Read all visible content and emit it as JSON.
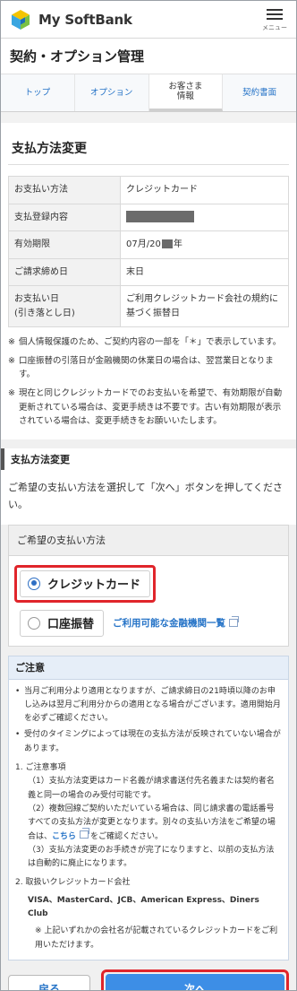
{
  "header": {
    "brand": "My SoftBank",
    "menu_label": "メニュー"
  },
  "page_title": "契約・オプション管理",
  "tabs": [
    {
      "label": "トップ",
      "active": false
    },
    {
      "label": "オプション",
      "active": false
    },
    {
      "label_line1": "お客さま",
      "label_line2": "情報",
      "active": true
    },
    {
      "label": "契約書面",
      "active": false
    }
  ],
  "section_title": "支払方法変更",
  "info_rows": [
    {
      "key": "お支払い方法",
      "value": "クレジットカード"
    },
    {
      "key": "支払登録内容",
      "value": ""
    },
    {
      "key": "有効期限",
      "value_prefix": "07月/20",
      "value_suffix": "年"
    },
    {
      "key": "ご請求締め日",
      "value": "末日"
    },
    {
      "key_line1": "お支払い日",
      "key_line2": "(引き落とし日)",
      "value": "ご利用クレジットカード会社の規約に基づく振替日"
    }
  ],
  "notes": [
    "個人情報保護のため、ご契約内容の一部を「＊」で表示しています。",
    "口座振替の引落日が金融機関の休業日の場合は、翌営業日となります。",
    "現在と同じクレジットカードでのお支払いを希望で、有効期限が自動更新されている場合は、変更手続きは不要です。古い有効期限が表示されている場合は、変更手続きをお願いいたします。"
  ],
  "note_mark": "※",
  "change_section": {
    "title": "支払方法変更",
    "lead": "ご希望の支払い方法を選択して「次へ」ボタンを押してください。",
    "panel_title": "ご希望の支払い方法",
    "options": [
      {
        "label": "クレジットカード",
        "selected": true
      },
      {
        "label": "口座振替",
        "selected": false
      }
    ],
    "bank_link": "ご利用可能な金融機関一覧"
  },
  "caution": {
    "title": "ご注意",
    "bullets": [
      "当月ご利用分より適用となりますが、ご請求締日の21時頃以降のお申し込みは翌月ご利用分からの適用となる場合がございます。適用開始月を必ずご確認ください。",
      "受付のタイミングによっては現在の支払方法が反映されていない場合があります。"
    ],
    "item1_title": "1. ご注意事項",
    "item1_p1": "（1）支払方法変更はカード名義が請求書送付先名義または契約者名義と同一の場合のみ受付可能です。",
    "item1_p2_a": "（2）複数回線ご契約いただいている場合は、同じ請求書の電話番号すべての支払方法が変更となります。別々の支払い方法をご希望の場合は、",
    "item1_p2_link": "こちら",
    "item1_p2_b": "をご確認ください。",
    "item1_p3": "（3）支払方法変更のお手続きが完了になりますと、以前の支払方法は自動的に廃止になります。",
    "item2_title": "2. 取扱いクレジットカード会社",
    "cards": "VISA、MasterCard、JCB、American Express、Diners Club",
    "cards_note": "※ 上記いずれかの会社名が記載されているクレジットカードをご利用いただけます。"
  },
  "buttons": {
    "back": "戻る",
    "next": "次へ"
  },
  "colors": {
    "accent_blue": "#3d8ee6",
    "link_blue": "#2573c7",
    "highlight_red": "#e0252b"
  }
}
